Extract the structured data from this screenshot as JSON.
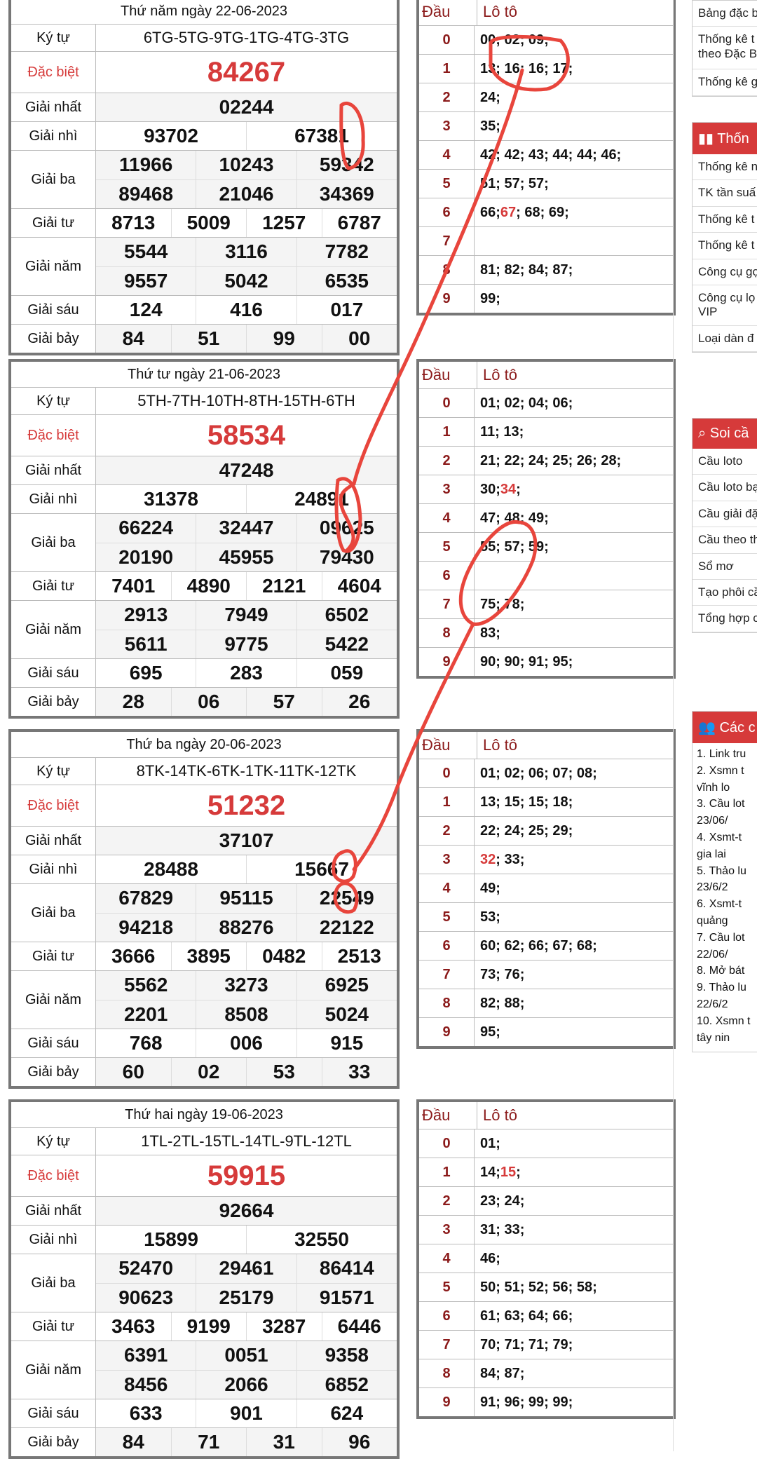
{
  "days": [
    {
      "title": "Thứ năm ngày 22-06-2023",
      "kytu": "6TG-5TG-9TG-1TG-4TG-3TG",
      "db": "84267",
      "g1": "02244",
      "g2": [
        "93702",
        "67381"
      ],
      "g3": [
        [
          "11966",
          "10243",
          "59342"
        ],
        [
          "89468",
          "21046",
          "34369"
        ]
      ],
      "g4": [
        "8713",
        "5009",
        "1257",
        "6787"
      ],
      "g5": [
        [
          "5544",
          "3116",
          "7782"
        ],
        [
          "9557",
          "5042",
          "6535"
        ]
      ],
      "g6": [
        "124",
        "416",
        "017"
      ],
      "g7": [
        "84",
        "51",
        "99",
        "00"
      ],
      "loto": [
        [
          {
            "t": "00; 02; 09;"
          }
        ],
        [
          {
            "t": "13; 16; 16; 17;"
          }
        ],
        [
          {
            "t": "24;"
          }
        ],
        [
          {
            "t": "35;"
          }
        ],
        [
          {
            "t": "42; 42; 43; 44; 44; 46;"
          }
        ],
        [
          {
            "t": "51; 57; 57;"
          }
        ],
        [
          {
            "t": "66; "
          },
          {
            "t": "67",
            "hl": true
          },
          {
            "t": "; 68; 69;"
          }
        ],
        [],
        [
          {
            "t": "81; 82; 84; 87;"
          }
        ],
        [
          {
            "t": "99;"
          }
        ]
      ]
    },
    {
      "title": "Thứ tư ngày 21-06-2023",
      "kytu": "5TH-7TH-10TH-8TH-15TH-6TH",
      "db": "58534",
      "g1": "47248",
      "g2": [
        "31378",
        "24891"
      ],
      "g3": [
        [
          "66224",
          "32447",
          "09625"
        ],
        [
          "20190",
          "45955",
          "79430"
        ]
      ],
      "g4": [
        "7401",
        "4890",
        "2121",
        "4604"
      ],
      "g5": [
        [
          "2913",
          "7949",
          "6502"
        ],
        [
          "5611",
          "9775",
          "5422"
        ]
      ],
      "g6": [
        "695",
        "283",
        "059"
      ],
      "g7": [
        "28",
        "06",
        "57",
        "26"
      ],
      "loto": [
        [
          {
            "t": "01; 02; 04; 06;"
          }
        ],
        [
          {
            "t": "11; 13;"
          }
        ],
        [
          {
            "t": "21; 22; 24; 25; 26; 28;"
          }
        ],
        [
          {
            "t": "30; "
          },
          {
            "t": "34",
            "hl": true
          },
          {
            "t": ";"
          }
        ],
        [
          {
            "t": "47; 48; 49;"
          }
        ],
        [
          {
            "t": "55; 57; 59;"
          }
        ],
        [],
        [
          {
            "t": "75; 78;"
          }
        ],
        [
          {
            "t": "83;"
          }
        ],
        [
          {
            "t": "90; 90; 91; 95;"
          }
        ]
      ]
    },
    {
      "title": "Thứ ba ngày 20-06-2023",
      "kytu": "8TK-14TK-6TK-1TK-11TK-12TK",
      "db": "51232",
      "g1": "37107",
      "g2": [
        "28488",
        "15667"
      ],
      "g3": [
        [
          "67829",
          "95115",
          "22549"
        ],
        [
          "94218",
          "88276",
          "22122"
        ]
      ],
      "g4": [
        "3666",
        "3895",
        "0482",
        "2513"
      ],
      "g5": [
        [
          "5562",
          "3273",
          "6925"
        ],
        [
          "2201",
          "8508",
          "5024"
        ]
      ],
      "g6": [
        "768",
        "006",
        "915"
      ],
      "g7": [
        "60",
        "02",
        "53",
        "33"
      ],
      "loto": [
        [
          {
            "t": "01; 02; 06; 07; 08;"
          }
        ],
        [
          {
            "t": "13; 15; 15; 18;"
          }
        ],
        [
          {
            "t": "22; 24; 25; 29;"
          }
        ],
        [
          {
            "t": "32",
            "hl": true
          },
          {
            "t": "; 33;"
          }
        ],
        [
          {
            "t": "49;"
          }
        ],
        [
          {
            "t": "53;"
          }
        ],
        [
          {
            "t": "60; 62; 66; 67; 68;"
          }
        ],
        [
          {
            "t": "73; 76;"
          }
        ],
        [
          {
            "t": "82; 88;"
          }
        ],
        [
          {
            "t": "95;"
          }
        ]
      ]
    },
    {
      "title": "Thứ hai ngày 19-06-2023",
      "kytu": "1TL-2TL-15TL-14TL-9TL-12TL",
      "db": "59915",
      "g1": "92664",
      "g2": [
        "15899",
        "32550"
      ],
      "g3": [
        [
          "52470",
          "29461",
          "86414"
        ],
        [
          "90623",
          "25179",
          "91571"
        ]
      ],
      "g4": [
        "3463",
        "9199",
        "3287",
        "6446"
      ],
      "g5": [
        [
          "6391",
          "0051",
          "9358"
        ],
        [
          "8456",
          "2066",
          "6852"
        ]
      ],
      "g6": [
        "633",
        "901",
        "624"
      ],
      "g7": [
        "84",
        "71",
        "31",
        "96"
      ],
      "loto": [
        [
          {
            "t": "01;"
          }
        ],
        [
          {
            "t": "14; "
          },
          {
            "t": "15",
            "hl": true
          },
          {
            "t": ";"
          }
        ],
        [
          {
            "t": "23; 24;"
          }
        ],
        [
          {
            "t": "31; 33;"
          }
        ],
        [
          {
            "t": "46;"
          }
        ],
        [
          {
            "t": "50; 51; 52; 56; 58;"
          }
        ],
        [
          {
            "t": "61; 63; 64; 66;"
          }
        ],
        [
          {
            "t": "70; 71; 71; 79;"
          }
        ],
        [
          {
            "t": "84; 87;"
          }
        ],
        [
          {
            "t": "91; 96; 99; 99;"
          }
        ]
      ]
    }
  ],
  "labels": {
    "kytu": "Ký tự",
    "db": "Đặc biệt",
    "g1": "Giải nhất",
    "g2": "Giải nhì",
    "g3": "Giải ba",
    "g4": "Giải tư",
    "g5": "Giải năm",
    "g6": "Giải sáu",
    "g7": "Giải bảy",
    "dau": "Đầu",
    "loto": "Lô tô"
  },
  "sidebar": {
    "top_items": [
      "Bảng đặc b",
      "Thống kê t theo Đặc B",
      "Thống kê g"
    ],
    "stats_head": "Thốn",
    "stats_items": [
      "Thống kê n",
      "TK tần suấ",
      "Thống kê t",
      "Thống kê t",
      "Công cụ gợ",
      "Công cụ lọ VIP",
      "Loại dàn đ"
    ],
    "soi_head": "Soi cầ",
    "soi_items": [
      "Cầu loto",
      "Cầu loto bạ",
      "Cầu giải đặ",
      "Cầu theo th",
      "Sổ mơ",
      "Tạo phôi cầ",
      "Tổng hợp c"
    ],
    "links_head": "Các c",
    "links": [
      "1. Link tru",
      "2. Xsmn t",
      "vĩnh lo",
      "3. Cầu lot",
      "23/06/",
      "4. Xsmt-t",
      "gia lai",
      "5. Thảo lu",
      "23/6/2",
      "6. Xsmt-t",
      "quảng",
      "7. Cầu lot",
      "22/06/",
      "8. Mở bát",
      "9. Thảo lu",
      "22/6/2",
      "10. Xsmn t",
      "tây nin"
    ]
  },
  "colors": {
    "accent": "#d63a3a",
    "dau": "#8b1a1a",
    "border": "#777777",
    "pen": "#e8453c"
  },
  "icons": {
    "stats": "bar-chart-icon",
    "soi": "search-icon",
    "links": "users-icon"
  }
}
